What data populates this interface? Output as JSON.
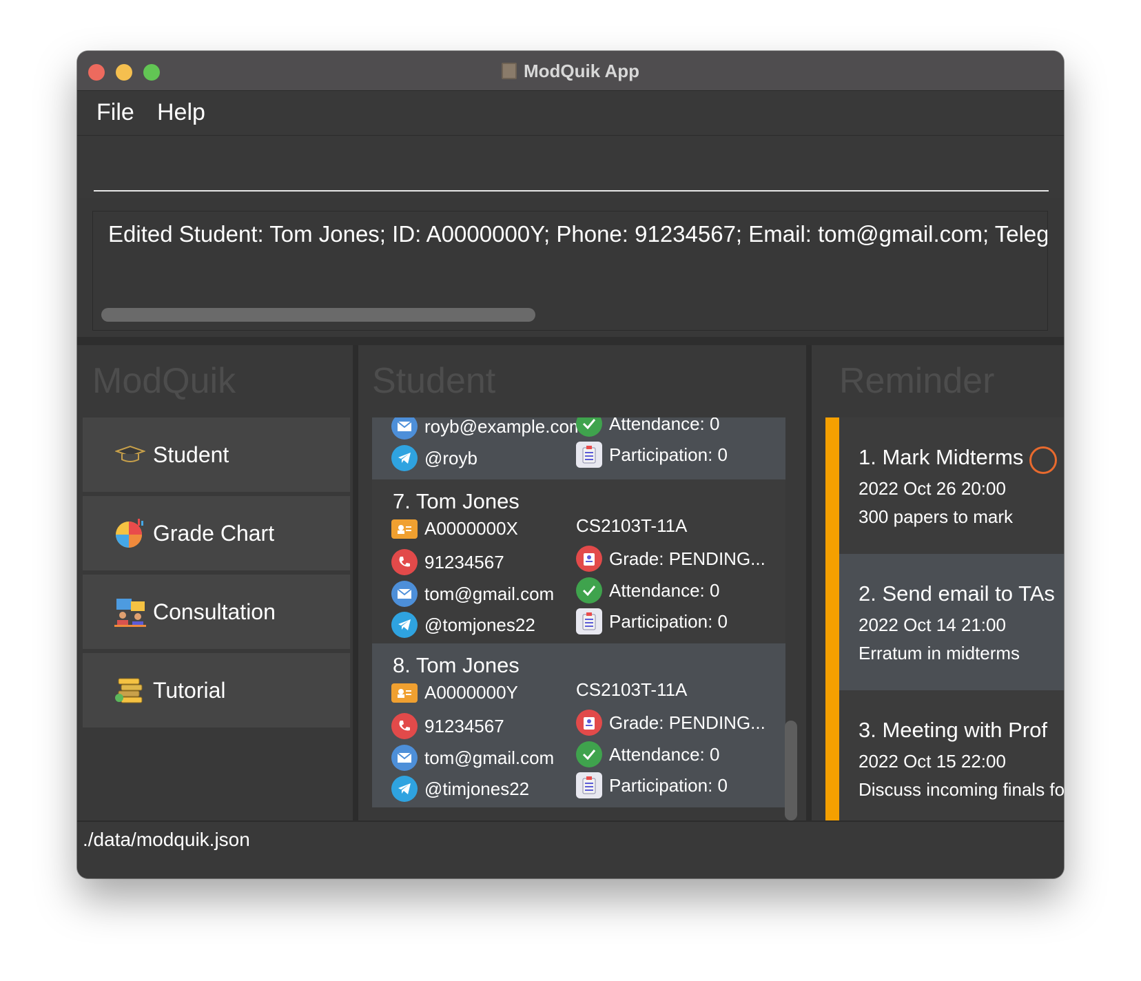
{
  "window": {
    "title": "ModQuik App"
  },
  "menu": {
    "file": "File",
    "help": "Help"
  },
  "command": {
    "value": ""
  },
  "result": {
    "text": "Edited Student: Tom Jones; ID: A0000000Y; Phone: 91234567; Email: tom@gmail.com; Teleg"
  },
  "sidebar": {
    "heading": "ModQuik",
    "items": [
      {
        "label": "Student",
        "icon": "graduation-cap-icon"
      },
      {
        "label": "Grade Chart",
        "icon": "pie-chart-icon"
      },
      {
        "label": "Consultation",
        "icon": "consultation-icon"
      },
      {
        "label": "Tutorial",
        "icon": "books-icon"
      }
    ]
  },
  "student_panel": {
    "heading": "Student",
    "partial_card": {
      "email": "royb@example.com",
      "telegram": "@royb",
      "attendance": "Attendance: 0",
      "participation": "Participation: 0"
    },
    "cards": [
      {
        "title": "7.  Tom Jones",
        "id": "A0000000X",
        "tutorial": "CS2103T-11A",
        "phone": "91234567",
        "grade": "Grade: PENDING...",
        "email": "tom@gmail.com",
        "attendance": "Attendance: 0",
        "telegram": "@tomjones22",
        "participation": "Participation: 0"
      },
      {
        "title": "8.  Tom Jones",
        "id": "A0000000Y",
        "tutorial": "CS2103T-11A",
        "phone": "91234567",
        "grade": "Grade: PENDING...",
        "email": "tom@gmail.com",
        "attendance": "Attendance: 0",
        "telegram": "@timjones22",
        "participation": "Participation: 0"
      }
    ]
  },
  "reminder_panel": {
    "heading": "Reminder",
    "items": [
      {
        "title": "1.  Mark Midterms",
        "date": "2022 Oct 26 20:00",
        "desc": "300 papers to mark"
      },
      {
        "title": "2.  Send email to TAs",
        "date": "2022 Oct 14 21:00",
        "desc": "Erratum in midterms"
      },
      {
        "title": "3.  Meeting with Prof",
        "date": "2022 Oct 15 22:00",
        "desc": "Discuss incoming finals fo"
      }
    ]
  },
  "status": {
    "path": "./data/modquik.json"
  },
  "colors": {
    "accent_bar": "#f5a000",
    "card_selected": "#4b4f54",
    "background": "#383838"
  }
}
